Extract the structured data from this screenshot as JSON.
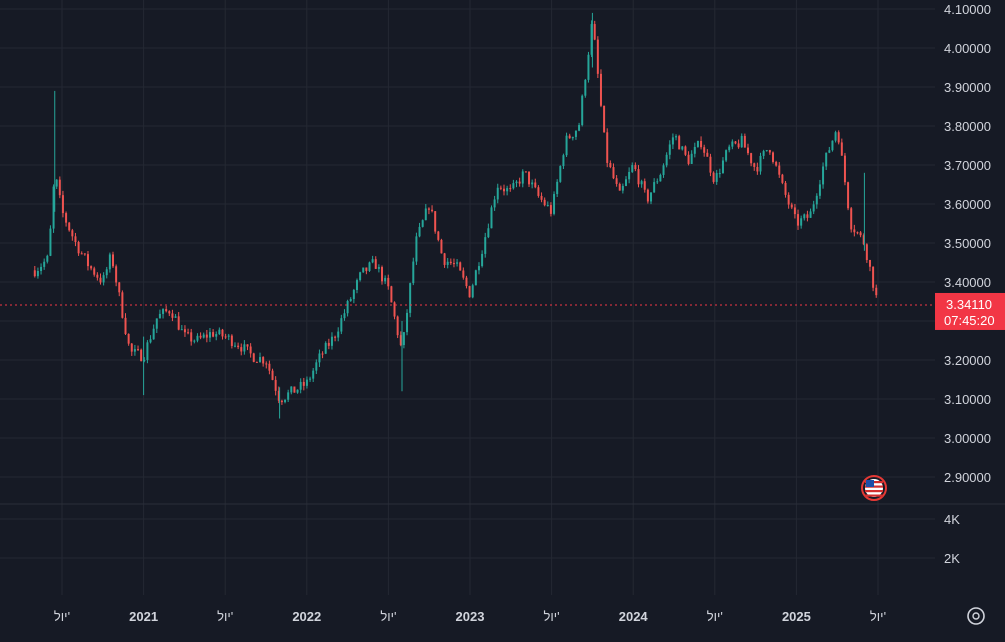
{
  "colors": {
    "background": "#161a25",
    "grid": "#242833",
    "text": "#d1d4dc",
    "up": "#26a69a",
    "down": "#ef5350",
    "price_line": "#f23645",
    "volume_scale": "#2a2e39"
  },
  "chart_data": {
    "type": "candlestick",
    "title": "",
    "xlabel": "",
    "ylabel": "",
    "ylim": [
      2.8,
      4.12
    ],
    "y_ticks": [
      "4.10000",
      "4.00000",
      "3.90000",
      "3.80000",
      "3.70000",
      "3.60000",
      "3.50000",
      "3.40000",
      "3.30000",
      "3.20000",
      "3.10000",
      "3.00000",
      "2.90000"
    ],
    "x_ticks": [
      "יול'",
      "2021",
      "יול'",
      "2022",
      "יול'",
      "2023",
      "יול'",
      "2024",
      "יול'",
      "2025",
      "יול'"
    ],
    "x_range": [
      "2020-05",
      "2025-07"
    ],
    "path_points": [
      {
        "x": "2020-05",
        "y": 3.43
      },
      {
        "x": "2020-06",
        "y": 3.46
      },
      {
        "x": "2020-06-15",
        "y": 3.68
      },
      {
        "x": "2020-07",
        "y": 3.58
      },
      {
        "x": "2020-08",
        "y": 3.5
      },
      {
        "x": "2020-09",
        "y": 3.44
      },
      {
        "x": "2020-10",
        "y": 3.4
      },
      {
        "x": "2020-10-20",
        "y": 3.47
      },
      {
        "x": "2020-11",
        "y": 3.4
      },
      {
        "x": "2020-12",
        "y": 3.22
      },
      {
        "x": "2021-01",
        "y": 3.21
      },
      {
        "x": "2021-02",
        "y": 3.31
      },
      {
        "x": "2021-03",
        "y": 3.33
      },
      {
        "x": "2021-04",
        "y": 3.26
      },
      {
        "x": "2021-05",
        "y": 3.25
      },
      {
        "x": "2021-06",
        "y": 3.27
      },
      {
        "x": "2021-07",
        "y": 3.26
      },
      {
        "x": "2021-08",
        "y": 3.24
      },
      {
        "x": "2021-09",
        "y": 3.21
      },
      {
        "x": "2021-10",
        "y": 3.2
      },
      {
        "x": "2021-11",
        "y": 3.1
      },
      {
        "x": "2021-12",
        "y": 3.12
      },
      {
        "x": "2022-01",
        "y": 3.14
      },
      {
        "x": "2022-02",
        "y": 3.21
      },
      {
        "x": "2022-03",
        "y": 3.26
      },
      {
        "x": "2022-04",
        "y": 3.34
      },
      {
        "x": "2022-05",
        "y": 3.42
      },
      {
        "x": "2022-06",
        "y": 3.45
      },
      {
        "x": "2022-07",
        "y": 3.38
      },
      {
        "x": "2022-08",
        "y": 3.22
      },
      {
        "x": "2022-09",
        "y": 3.5
      },
      {
        "x": "2022-10",
        "y": 3.6
      },
      {
        "x": "2022-11",
        "y": 3.46
      },
      {
        "x": "2022-12",
        "y": 3.44
      },
      {
        "x": "2023-01",
        "y": 3.37
      },
      {
        "x": "2023-02",
        "y": 3.5
      },
      {
        "x": "2023-03",
        "y": 3.65
      },
      {
        "x": "2023-04",
        "y": 3.63
      },
      {
        "x": "2023-05",
        "y": 3.68
      },
      {
        "x": "2023-06",
        "y": 3.62
      },
      {
        "x": "2023-07",
        "y": 3.58
      },
      {
        "x": "2023-08",
        "y": 3.76
      },
      {
        "x": "2023-09",
        "y": 3.8
      },
      {
        "x": "2023-10",
        "y": 4.07
      },
      {
        "x": "2023-11",
        "y": 3.72
      },
      {
        "x": "2023-12",
        "y": 3.62
      },
      {
        "x": "2024-01",
        "y": 3.7
      },
      {
        "x": "2024-02",
        "y": 3.61
      },
      {
        "x": "2024-03",
        "y": 3.68
      },
      {
        "x": "2024-04",
        "y": 3.78
      },
      {
        "x": "2024-05",
        "y": 3.71
      },
      {
        "x": "2024-06",
        "y": 3.76
      },
      {
        "x": "2024-07",
        "y": 3.66
      },
      {
        "x": "2024-08",
        "y": 3.74
      },
      {
        "x": "2024-09",
        "y": 3.76
      },
      {
        "x": "2024-10",
        "y": 3.69
      },
      {
        "x": "2024-11",
        "y": 3.75
      },
      {
        "x": "2024-12",
        "y": 3.64
      },
      {
        "x": "2025-01",
        "y": 3.55
      },
      {
        "x": "2025-02",
        "y": 3.57
      },
      {
        "x": "2025-03",
        "y": 3.7
      },
      {
        "x": "2025-04",
        "y": 3.8
      },
      {
        "x": "2025-05",
        "y": 3.55
      },
      {
        "x": "2025-06",
        "y": 3.5
      },
      {
        "x": "2025-07",
        "y": 3.34
      }
    ],
    "spikes": [
      {
        "x": "2020-06-15",
        "high": 3.89,
        "low": 3.58
      },
      {
        "x": "2021-01",
        "high": 3.26,
        "low": 3.11
      },
      {
        "x": "2021-11",
        "high": 3.13,
        "low": 3.05
      },
      {
        "x": "2022-08",
        "high": 3.3,
        "low": 3.12
      },
      {
        "x": "2023-10",
        "high": 4.09,
        "low": 3.95
      },
      {
        "x": "2025-06",
        "high": 3.68,
        "low": 3.48
      }
    ],
    "last_price": "3.34110",
    "countdown": "07:45:20",
    "last_value": 3.3411
  },
  "volume_scale": {
    "labels": [
      "4K",
      "2K"
    ]
  },
  "settings_icon": "gear-icon",
  "marker_icon": "us-flag-icon"
}
